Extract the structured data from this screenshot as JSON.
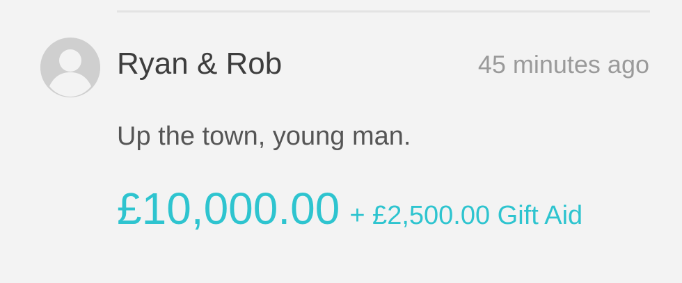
{
  "donation": {
    "donor_name": "Ryan & Rob",
    "timestamp": "45 minutes ago",
    "message": "Up the town, young man.",
    "amount": "£10,000.00",
    "gift_aid": "+ £2,500.00 Gift Aid",
    "avatar_icon": "default-user-avatar-icon"
  },
  "colors": {
    "background": "#f3f3f3",
    "accent": "#2ec4cf",
    "avatar": "#cfcfcf"
  }
}
